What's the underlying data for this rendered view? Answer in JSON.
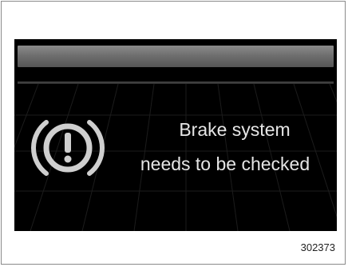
{
  "display": {
    "message_line_1": "Brake system",
    "message_line_2": "needs to be checked",
    "warning_icon": "brake-warning-icon",
    "colors": {
      "background": "#000000",
      "text": "#e6e6e6",
      "icon": "#cfcfcf"
    }
  },
  "figure": {
    "id": "302373"
  }
}
